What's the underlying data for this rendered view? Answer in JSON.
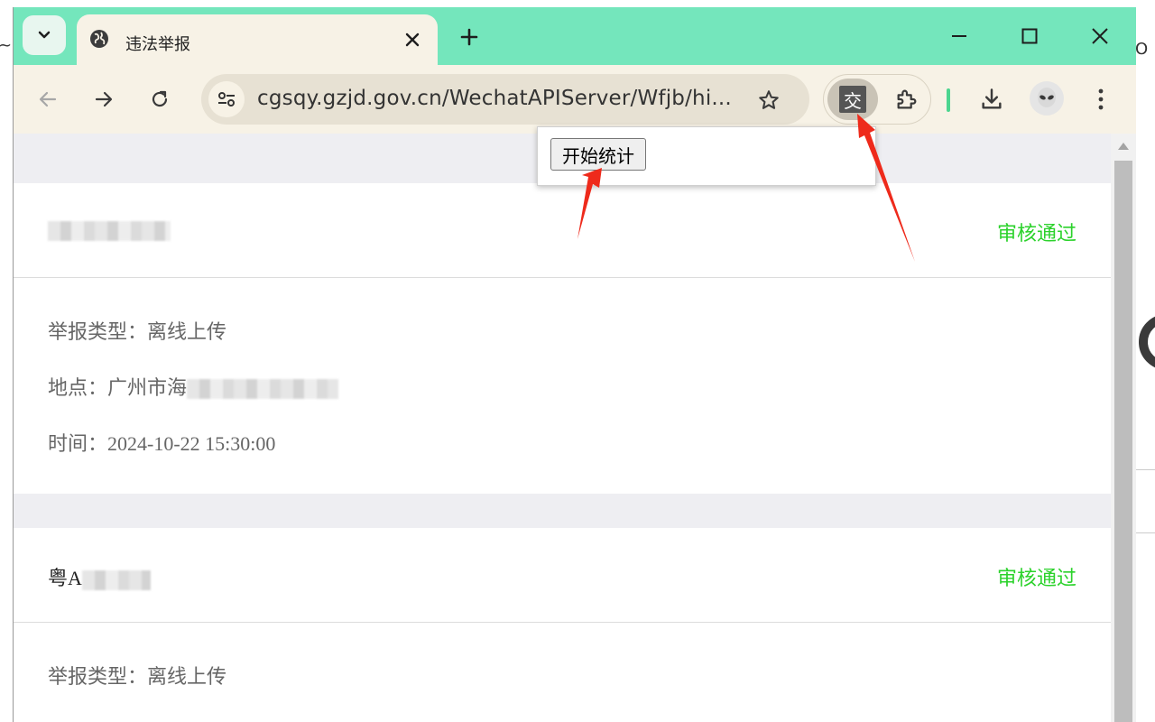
{
  "browser": {
    "tab": {
      "title": "违法举报"
    },
    "address_bar": {
      "url": "cgsqy.gzjd.gov.cn/WechatAPIServer/Wfjb/hi..."
    },
    "extension_popup": {
      "button_label": "开始统计"
    }
  },
  "desktop_fragments": {
    "left_text": "~",
    "right_text": "O"
  },
  "records": [
    {
      "plate": "",
      "status": "审核通过",
      "type_label": "举报类型：",
      "type_value": "离线上传",
      "location_label": "地点：",
      "location_value": "广州市海",
      "time_label": "时间：",
      "time_value": "2024-10-22 15:30:00"
    },
    {
      "plate": "粤A",
      "status": "审核通过",
      "type_label": "举报类型：",
      "type_value": "离线上传"
    }
  ],
  "colors": {
    "tabstrip": "#74e6bc",
    "toolbar": "#f7f2e6",
    "status_green": "#2bd22b",
    "annotation_arrow": "#ee2a1b"
  }
}
